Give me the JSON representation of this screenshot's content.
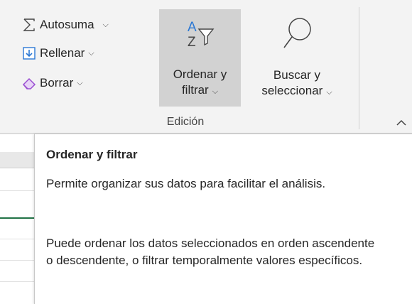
{
  "editing_group": {
    "label": "Edición",
    "autosum": {
      "label": "Autosuma",
      "icon": "sigma-icon"
    },
    "fill": {
      "label": "Rellenar",
      "icon": "fill-down-icon"
    },
    "clear": {
      "label": "Borrar",
      "icon": "eraser-icon"
    },
    "sort_filter": {
      "line1": "Ordenar y",
      "line2": "filtrar",
      "icon": "sort-az-filter-icon"
    },
    "find_select": {
      "line1": "Buscar y",
      "line2": "seleccionar",
      "icon": "magnifier-icon"
    }
  },
  "tooltip": {
    "title": "Ordenar y filtrar",
    "paragraph1": "Permite organizar sus datos para facilitar el análisis.",
    "paragraph2": "Puede ordenar los datos seleccionados en orden ascendente o descendente, o filtrar temporalmente valores específicos."
  },
  "colors": {
    "ribbon_bg": "#f3f3f3",
    "pressed_button": "#d2d2d2",
    "accent_blue": "#2b78d4",
    "eraser_purple": "#9a4fd1",
    "excel_green": "#217346"
  }
}
